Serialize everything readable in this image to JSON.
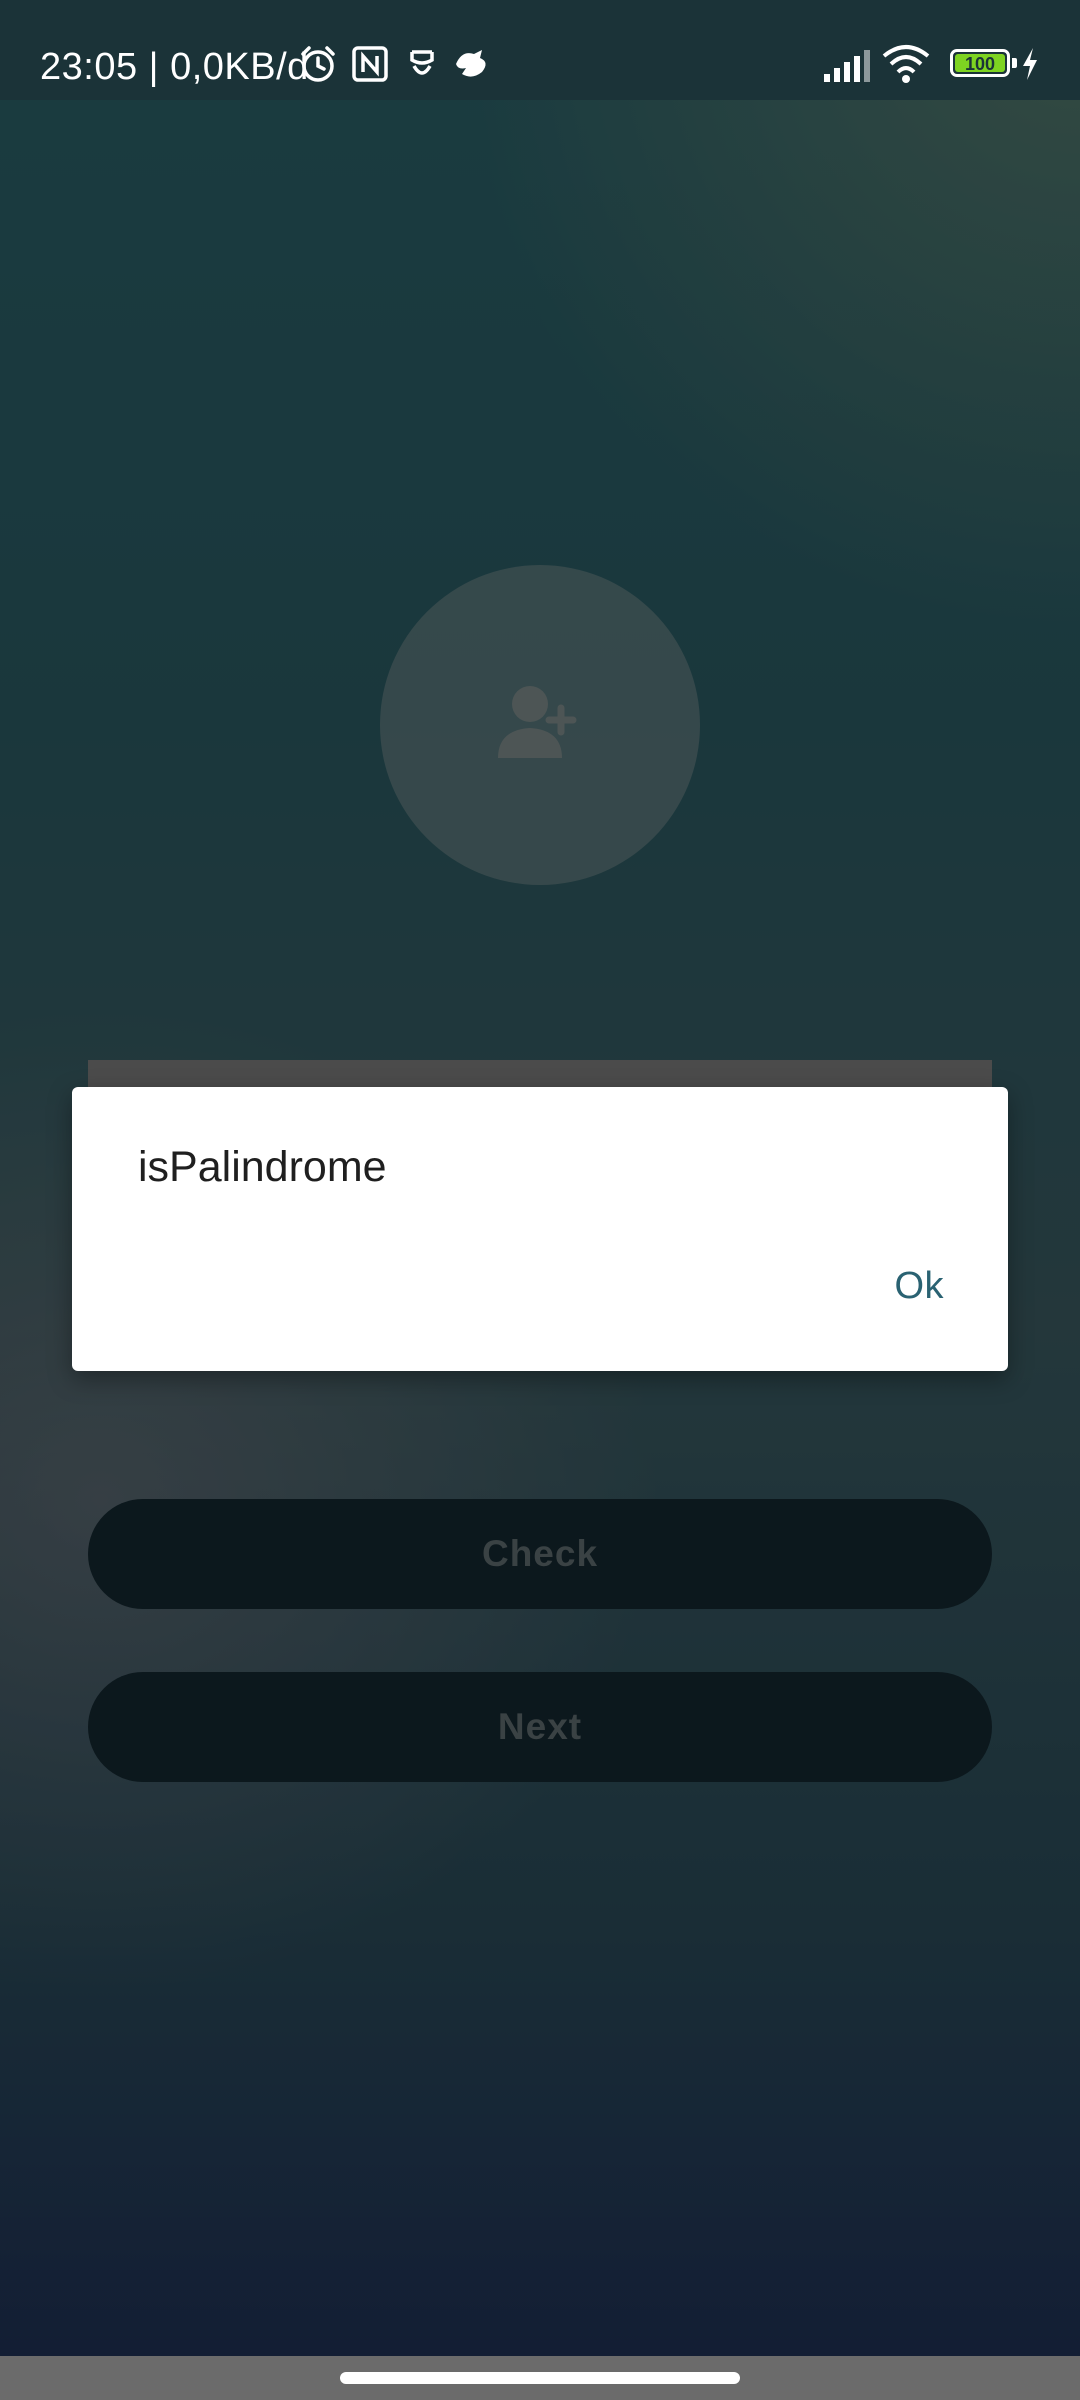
{
  "status_bar": {
    "time_text": "23:05 | 0,0KB/d",
    "battery_level": "100",
    "icons": [
      "alarm-icon",
      "nfc-icon",
      "mask-icon",
      "bird-icon",
      "signal-icon",
      "wifi-icon",
      "battery-icon",
      "charging-icon"
    ]
  },
  "main": {
    "avatar_icon": "add-person-icon",
    "name_input_value": "",
    "check_label": "Check",
    "next_label": "Next"
  },
  "dialog": {
    "title": "isPalindrome",
    "ok_label": "Ok"
  },
  "colors": {
    "dialog_button": "#2a6272",
    "button_bg": "#14272f",
    "battery": "#7ed321"
  }
}
